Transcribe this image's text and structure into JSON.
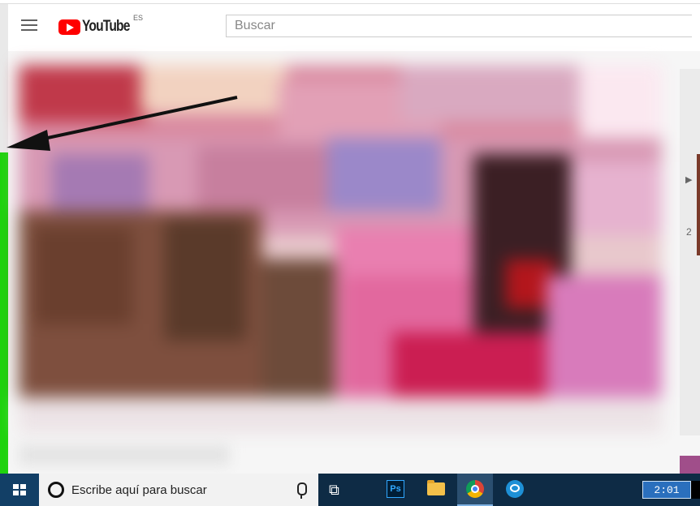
{
  "header": {
    "logo_text": "YouTube",
    "country_code": "ES",
    "search_placeholder": "Buscar"
  },
  "sidebar_right": {
    "play_glyph": "▶",
    "number": "2"
  },
  "taskbar": {
    "search_text": "Escribe aquí para buscar",
    "apps": [
      {
        "name": "photoshop",
        "label": "Ps"
      },
      {
        "name": "file-explorer"
      },
      {
        "name": "chrome",
        "active": true
      },
      {
        "name": "chat-app"
      }
    ],
    "clock": "2:01"
  },
  "colors": {
    "accent_green": "#1fd30e",
    "youtube_red": "#ff0000",
    "taskbar": "#0e2b45"
  },
  "icons": [
    "hamburger-icon",
    "youtube-logo-icon",
    "windows-icon",
    "cortana-icon",
    "microphone-icon",
    "task-view-icon",
    "arrow-icon"
  ]
}
